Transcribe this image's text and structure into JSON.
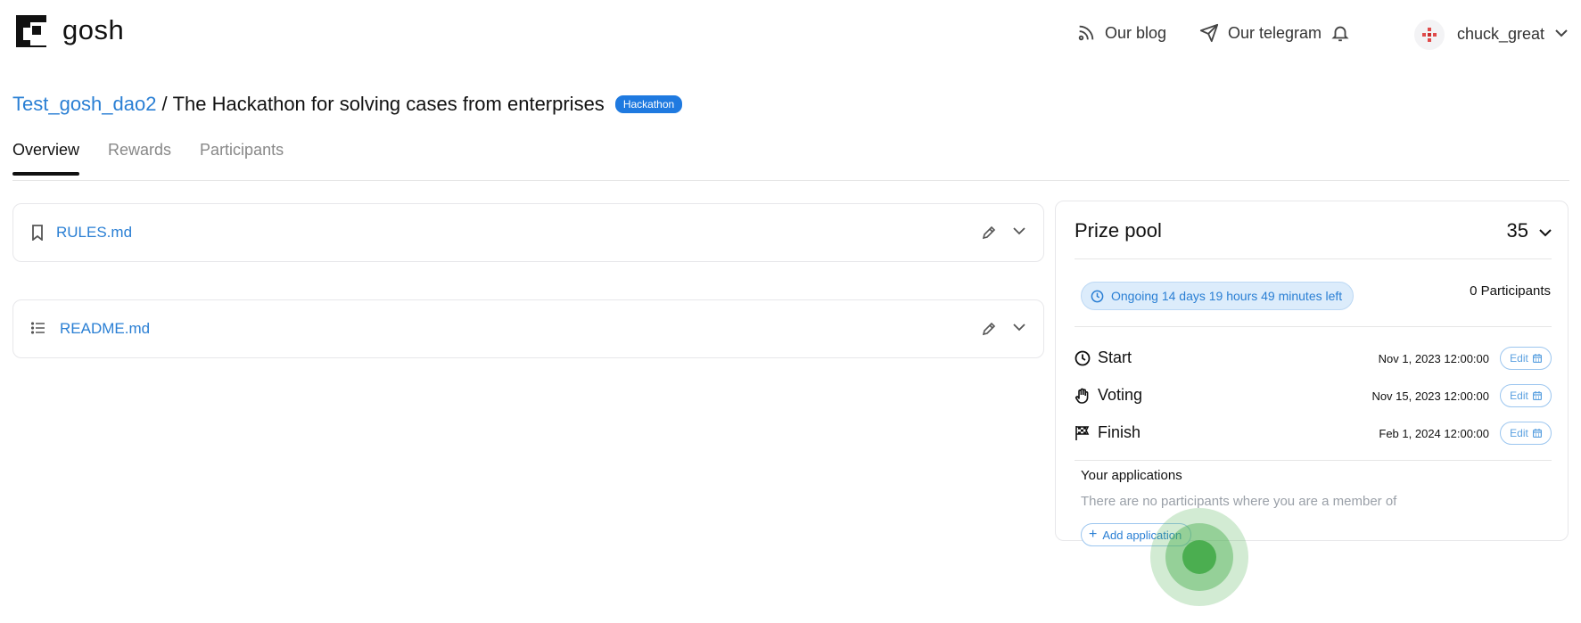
{
  "header": {
    "logo_text": "gosh",
    "blog_label": "Our blog",
    "telegram_label": "Our telegram",
    "username": "chuck_great"
  },
  "title": {
    "dao_name": "Test_gosh_dao2",
    "separator": "/",
    "event_title": "The Hackathon for solving cases from enterprises",
    "badge": "Hackathon"
  },
  "tabs": [
    {
      "label": "Overview",
      "active": true
    },
    {
      "label": "Rewards",
      "active": false
    },
    {
      "label": "Participants",
      "active": false
    }
  ],
  "files": [
    {
      "name": "RULES.md",
      "icon": "bookmark-icon"
    },
    {
      "name": "README.md",
      "icon": "list-icon"
    }
  ],
  "prize_pool": {
    "title": "Prize pool",
    "value": "35",
    "status": "Ongoing 14 days 19 hours 49 minutes left",
    "participants": "0 Participants",
    "stages": [
      {
        "name": "Start",
        "date": "Nov 1, 2023 12:00:00",
        "icon": "clock-icon",
        "edit_label": "Edit"
      },
      {
        "name": "Voting",
        "date": "Nov 15, 2023 12:00:00",
        "icon": "hand-icon",
        "edit_label": "Edit"
      },
      {
        "name": "Finish",
        "date": "Feb 1, 2024 12:00:00",
        "icon": "flag-icon",
        "edit_label": "Edit"
      }
    ],
    "applications_title": "Your applications",
    "applications_empty": "There are no participants where you are a member of",
    "add_application_label": "Add application"
  },
  "colors": {
    "accent": "#2a7fd4",
    "badge_bg": "#1f7ae0",
    "click_indicator": "#43aa48"
  }
}
